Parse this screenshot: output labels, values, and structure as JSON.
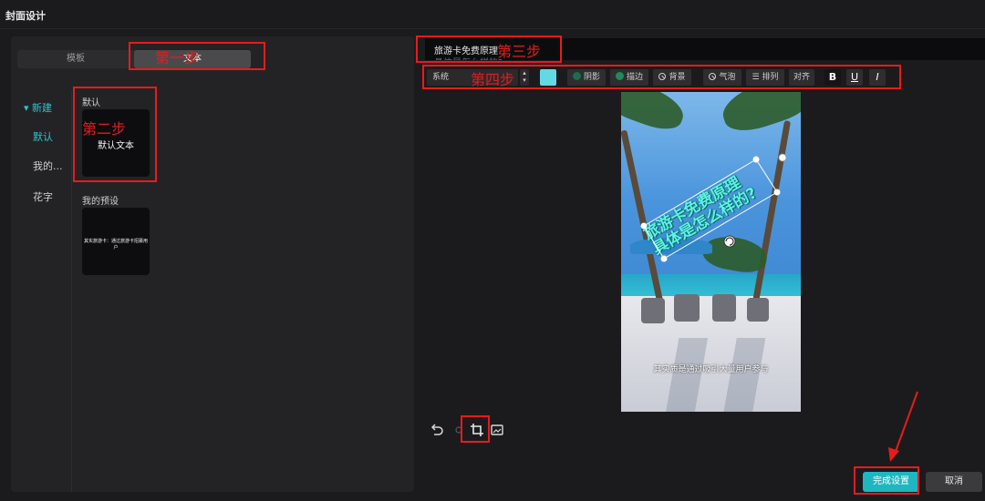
{
  "window": {
    "title": "封面设计"
  },
  "left": {
    "tabs": [
      {
        "label": "模板"
      },
      {
        "label": "文本"
      }
    ],
    "nav": [
      {
        "label": "▾ 新建"
      },
      {
        "label": "默认"
      },
      {
        "label": "我的..."
      },
      {
        "label": "花字"
      }
    ],
    "default_section": {
      "label": "默认",
      "card_text": "默认文本"
    },
    "my_presets": {
      "label": "我的预设",
      "card_text": "其实旅游卡：通过旅游卡招募用户"
    }
  },
  "editor": {
    "text_line1": "旅游卡免费原理",
    "text_line2": "具体是怎么样的?",
    "toolbar": {
      "font": "系统",
      "color_swatch": "#63d9e6",
      "shadow": "阴影",
      "stroke": "描边",
      "background": "背景",
      "bubble": "气泡",
      "arrange": "排列",
      "align": "对齐",
      "bold": "B",
      "underline": "U",
      "italic": "I"
    }
  },
  "canvas": {
    "overlay_line1": "旅游卡免费原理",
    "overlay_line2": "具体是怎么样的?",
    "subtitle": "其实质是通过吸引大量用户参与"
  },
  "actions": {
    "done": "完成设置",
    "cancel": "取消"
  },
  "annotations": {
    "step1": "第一步",
    "step2": "第二步",
    "step3": "第三步",
    "step4": "第四步",
    "color": "#e81b1b"
  }
}
